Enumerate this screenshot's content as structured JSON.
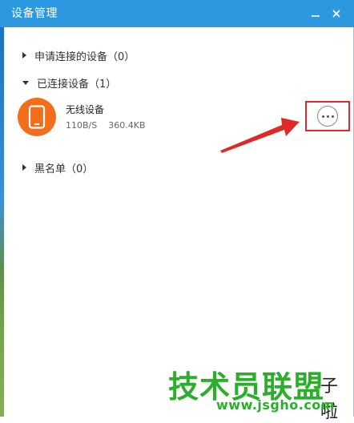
{
  "window": {
    "title": "设备管理"
  },
  "titlebar": {
    "minimize_glyph": "−",
    "close_glyph": "✕"
  },
  "sections": {
    "pending": {
      "label": "申请连接的设备（0）",
      "expanded": false
    },
    "connected": {
      "label": "已连接设备（1）",
      "expanded": true
    },
    "blacklist": {
      "label": "黑名单（0）",
      "expanded": false
    }
  },
  "device": {
    "name": "无线设备",
    "speed": "110B/S",
    "size": "360.4KB",
    "icon": "phone-icon",
    "avatar_color": "#f36e1a"
  },
  "more_button": {
    "icon": "more-dots-icon"
  },
  "annotation": {
    "color": "#e02a2a"
  },
  "watermark": {
    "main": "技术员联盟",
    "side": "子啦",
    "url": "www.jsgho.com"
  },
  "colors": {
    "titlebar": "#2b98e0",
    "watermark": "#2cae2c"
  }
}
